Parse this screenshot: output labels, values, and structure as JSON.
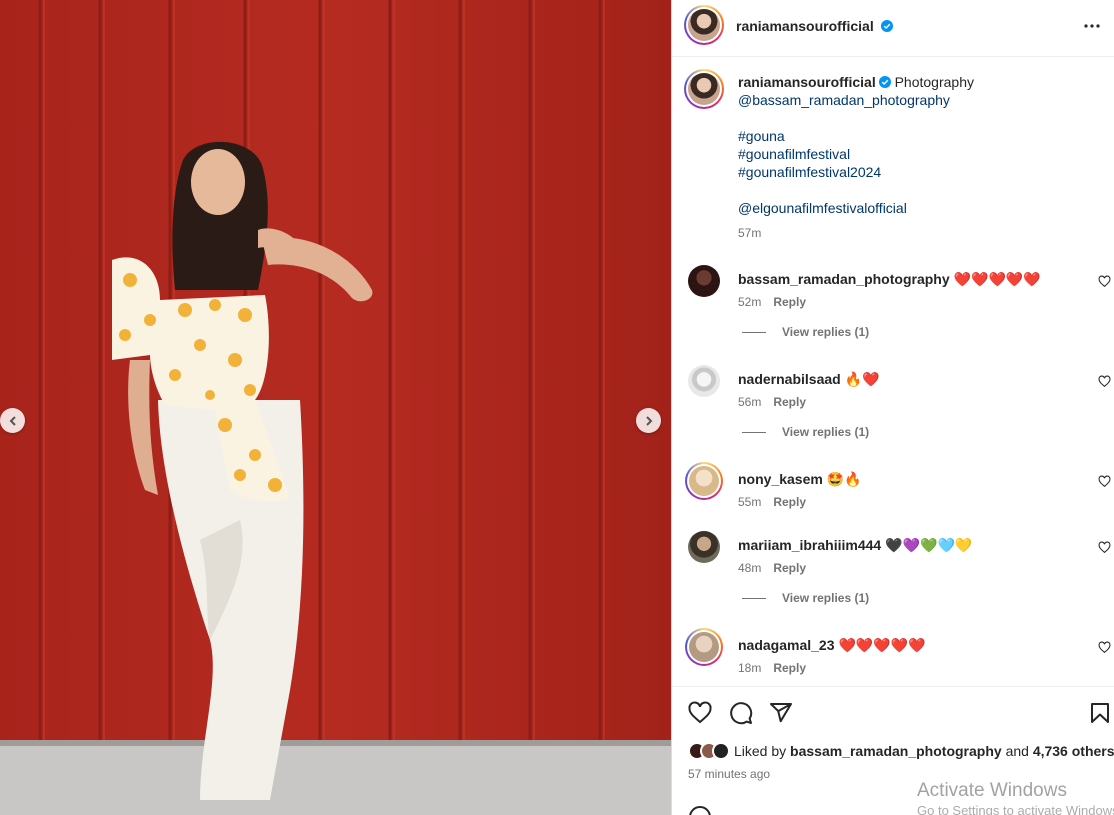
{
  "post": {
    "author": "raniamansourofficial",
    "verified": true,
    "caption": {
      "word": "Photography",
      "mention_photographer": "@bassam_ramadan_photography",
      "hashtags": [
        "#gouna",
        "#gounafilmfestival",
        "#gounafilmfestival2024"
      ],
      "mention_festival": "@elgounafilmfestivalofficial",
      "time": "57m"
    },
    "image": {
      "carousel": true
    }
  },
  "comments": [
    {
      "username": "bassam_ramadan_photography",
      "text": "❤️❤️❤️❤️❤️",
      "time": "52m",
      "reply_label": "Reply",
      "view_replies": "View replies (1)"
    },
    {
      "username": "nadernabilsaad",
      "text": "🔥❤️",
      "time": "56m",
      "reply_label": "Reply",
      "view_replies": "View replies (1)"
    },
    {
      "username": "nony_kasem",
      "text": "🤩🔥",
      "time": "55m",
      "reply_label": "Reply",
      "view_replies": null
    },
    {
      "username": "mariiam_ibrahiiim444",
      "text": "🖤💜💚🩵💛",
      "time": "48m",
      "reply_label": "Reply",
      "view_replies": "View replies (1)"
    },
    {
      "username": "nadagamal_23",
      "text": "❤️❤️❤️❤️❤️",
      "time": "18m",
      "reply_label": "Reply",
      "view_replies": null
    }
  ],
  "likes": {
    "prefix": "Liked by",
    "by": "bassam_ramadan_photography",
    "and": "and",
    "others": "4,736 others"
  },
  "posted": "57 minutes ago",
  "icons": {
    "more": "more-options-icon",
    "like": "heart-icon",
    "comment": "comment-icon",
    "share": "share-icon",
    "save": "bookmark-icon",
    "prev": "chevron-left-icon",
    "next": "chevron-right-icon"
  },
  "watermark": {
    "title": "Activate Windows",
    "subtitle": "Go to Settings to activate Windows."
  }
}
